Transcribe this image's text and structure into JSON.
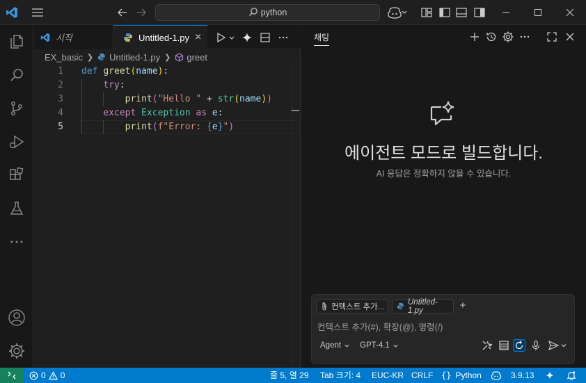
{
  "titlebar": {
    "search_text": "python",
    "icons": [
      "vscode-logo-icon",
      "menu-icon",
      "back-arrow-icon",
      "forward-arrow-icon",
      "copilot-icon",
      "layout-customize-icon",
      "toggle-sidebar-icon",
      "toggle-panel-icon",
      "toggle-secondary-sidebar-icon",
      "minimize-icon",
      "maximize-icon",
      "close-icon"
    ]
  },
  "activitybar": {
    "items": [
      "explorer-icon",
      "search-icon",
      "source-control-icon",
      "run-debug-icon",
      "extensions-icon",
      "testing-icon",
      "more-icon"
    ],
    "bottom": [
      "accounts-icon",
      "manage-gear-icon"
    ]
  },
  "editor": {
    "tabs": [
      {
        "label": "시작",
        "active": false
      },
      {
        "label": "Untitled-1.py",
        "active": true
      }
    ],
    "breadcrumb": [
      "EX_basic",
      "Untitled-1.py",
      "greet"
    ],
    "lines": [
      {
        "n": "1",
        "tokens": [
          [
            "def",
            "k"
          ],
          [
            " ",
            "w"
          ],
          [
            "greet",
            "f"
          ],
          [
            "(",
            "y"
          ],
          [
            "name",
            "p"
          ],
          [
            ")",
            "y"
          ],
          [
            ":",
            "w"
          ]
        ]
      },
      {
        "n": "2",
        "tokens": [
          [
            "    ",
            "w"
          ],
          [
            "try",
            "c"
          ],
          [
            ":",
            "w"
          ]
        ]
      },
      {
        "n": "3",
        "tokens": [
          [
            "        ",
            "w"
          ],
          [
            "print",
            "f"
          ],
          [
            "(",
            "v"
          ],
          [
            "\"Hello \"",
            "s"
          ],
          [
            " + ",
            "w"
          ],
          [
            "str",
            "t"
          ],
          [
            "(",
            "y"
          ],
          [
            "name",
            "p"
          ],
          [
            ")",
            "y"
          ],
          [
            ")",
            "v"
          ]
        ]
      },
      {
        "n": "4",
        "tokens": [
          [
            "    ",
            "w"
          ],
          [
            "except",
            "c"
          ],
          [
            " ",
            "w"
          ],
          [
            "Exception",
            "t"
          ],
          [
            " ",
            "w"
          ],
          [
            "as",
            "c"
          ],
          [
            " ",
            "w"
          ],
          [
            "e",
            "p"
          ],
          [
            ":",
            "w"
          ]
        ]
      },
      {
        "n": "5",
        "tokens": [
          [
            "        ",
            "w"
          ],
          [
            "print",
            "f"
          ],
          [
            "(",
            "v"
          ],
          [
            "f\"Error: ",
            "s"
          ],
          [
            "{",
            "k"
          ],
          [
            "e",
            "p"
          ],
          [
            "}",
            "k"
          ],
          [
            "\"",
            "s"
          ],
          [
            ")",
            "v"
          ]
        ]
      }
    ]
  },
  "chat": {
    "title": "채팅",
    "heading": "에이전트 모드로 빌드합니다.",
    "subtitle": "AI 응답은 정확하지 않을 수 있습니다.",
    "chip_context": "컨텍스트 추가...",
    "chip_file": "Untitled-1.py",
    "placeholder": "컨텍스트 추가(#), 확장(@), 명령(/)",
    "mode": "Agent",
    "model": "GPT-4.1"
  },
  "statusbar": {
    "errors": "0",
    "warnings": "0",
    "position": "줄 5, 열 29",
    "tab_size": "Tab 크기: 4",
    "encoding": "EUC-KR",
    "eol": "CRLF",
    "language": "Python",
    "python_version": "3.9.13"
  },
  "colors": {
    "accent": "#007acc",
    "remote": "#16825d",
    "editor_bg": "#1f1f1f",
    "sidebar_bg": "#181818"
  }
}
